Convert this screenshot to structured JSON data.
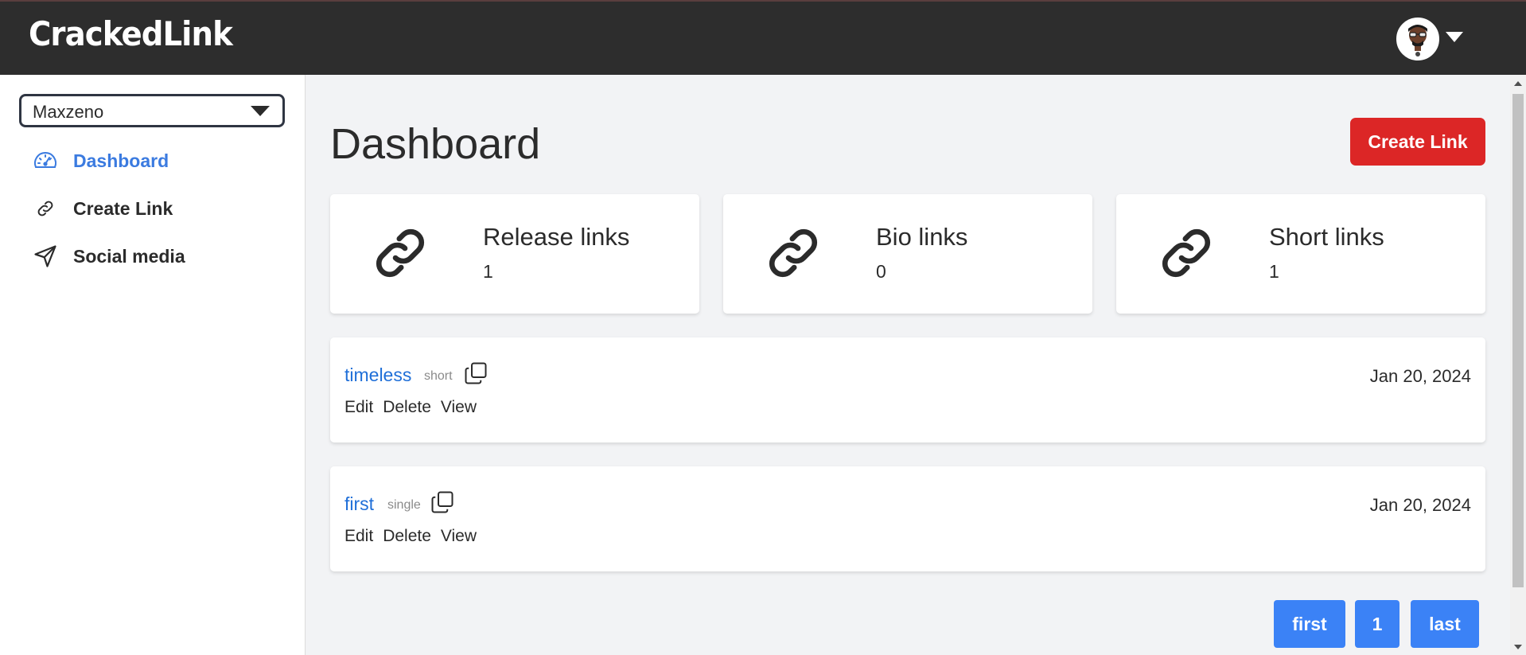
{
  "app": {
    "brand": "CrackedLink"
  },
  "header": {
    "avatar_icon": "user-avatar-icon",
    "menu_icon": "caret-down-icon"
  },
  "sidebar": {
    "org_select": {
      "value": "Maxzeno"
    },
    "items": [
      {
        "label": "Dashboard",
        "icon": "speedometer-icon",
        "active": true
      },
      {
        "label": "Create Link",
        "icon": "link-icon",
        "active": false
      },
      {
        "label": "Social media",
        "icon": "send-icon",
        "active": false
      }
    ]
  },
  "main": {
    "title": "Dashboard",
    "create_button": "Create Link",
    "stats": [
      {
        "title": "Release links",
        "count": "1",
        "icon": "link-icon"
      },
      {
        "title": "Bio links",
        "count": "0",
        "icon": "link-icon"
      },
      {
        "title": "Short links",
        "count": "1",
        "icon": "link-icon"
      }
    ],
    "links": [
      {
        "name": "timeless",
        "type": "short",
        "date": "Jan 20, 2024",
        "actions": [
          "Edit",
          "Delete",
          "View"
        ]
      },
      {
        "name": "first",
        "type": "single",
        "date": "Jan 20, 2024",
        "actions": [
          "Edit",
          "Delete",
          "View"
        ]
      }
    ],
    "pagination": {
      "first": "first",
      "page": "1",
      "last": "last"
    }
  },
  "colors": {
    "header_bg": "#2d2d2d",
    "accent_blue": "#3b82f6",
    "link_blue": "#1f6fd8",
    "danger": "#dc2626"
  }
}
